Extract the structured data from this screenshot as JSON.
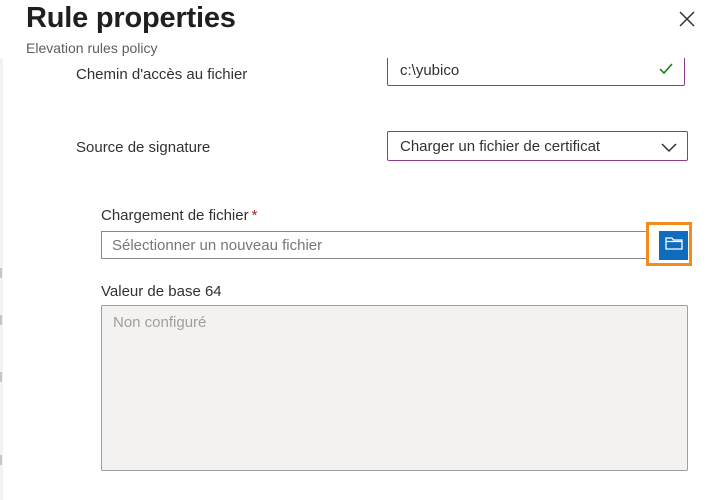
{
  "panel": {
    "title": "Rule properties",
    "subtitle": "Elevation rules policy"
  },
  "fields": {
    "file_path": {
      "label": "Chemin d'accès au fichier",
      "value": "c:\\yubico"
    },
    "signature_source": {
      "label": "Source de signature",
      "selected": "Charger un fichier de certificat"
    },
    "file_upload": {
      "label": "Chargement de fichier",
      "required_mark": "*",
      "placeholder": "Sélectionner un nouveau fichier"
    },
    "base64_value": {
      "label": "Valeur de base 64",
      "placeholder": "Non configuré"
    }
  },
  "colors": {
    "accent": "#0f6cbd",
    "highlight": "#f28c1c",
    "field_border": "#8a3c8e",
    "success": "#107c10",
    "required": "#a4262c"
  },
  "icons": {
    "close": "close-icon",
    "valid": "checkmark-icon",
    "dropdown": "chevron-down-icon",
    "browse": "folder-icon"
  }
}
